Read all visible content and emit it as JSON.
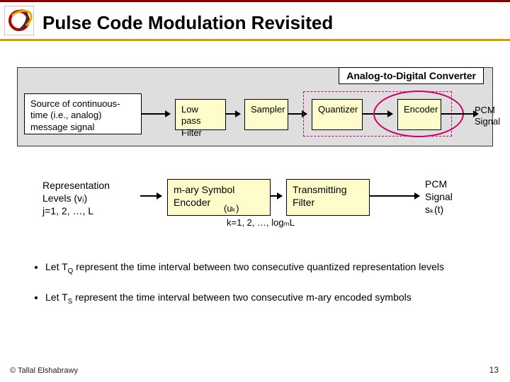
{
  "header": {
    "title": "Pulse Code Modulation Revisited"
  },
  "adc": {
    "label": "Analog-to-Digital Converter",
    "source": "Source of continuous-time (i.e., analog) message signal",
    "lpf": "Low pass Filter",
    "sampler": "Sampler",
    "quantizer": "Quantizer",
    "encoder": "Encoder",
    "pcm_out": "PCM Signal"
  },
  "row2": {
    "rep_line1": "Representation",
    "rep_line2": "Levels (vⱼ)",
    "rep_line3": "j=1, 2, …, L",
    "mary": "m-ary Symbol Encoder",
    "uk": "(uₖ)",
    "klabel": "k=1, 2, …, logₘL",
    "txfilter": "Transmitting Filter",
    "pcm2_line1": "PCM",
    "pcm2_line2": "Signal",
    "pcm2_line3": "sₖ(t)"
  },
  "bullets": {
    "b1_pre": "Let T",
    "b1_sub": "Q",
    "b1_post": " represent the time interval between two consecutive quantized representation levels",
    "b2_pre": "Let T",
    "b2_sub": "S",
    "b2_post": " represent the time interval between two consecutive m-ary encoded symbols"
  },
  "footer": {
    "copyright": "© Tallal Elshabrawy",
    "page": "13"
  }
}
